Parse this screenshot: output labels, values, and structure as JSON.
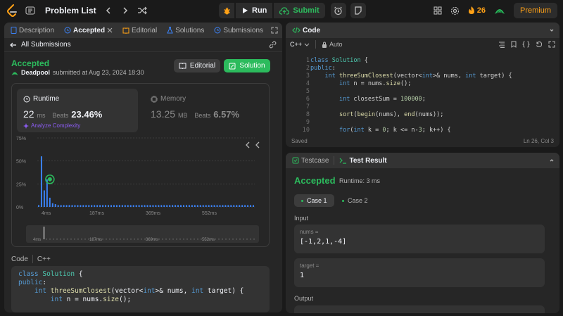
{
  "topbar": {
    "title": "Problem List",
    "run_label": "Run",
    "submit_label": "Submit",
    "streak_count": "26",
    "premium_label": "Premium"
  },
  "left_tabs": [
    {
      "label": "Description"
    },
    {
      "label": "Accepted"
    },
    {
      "label": "Editorial"
    },
    {
      "label": "Solutions"
    },
    {
      "label": "Submissions"
    }
  ],
  "submission": {
    "back_label": "All Submissions",
    "status": "Accepted",
    "user": "Deadpool",
    "submitted_text": "submitted at Aug 23, 2024 18:30",
    "editorial_btn": "Editorial",
    "solution_btn": "Solution",
    "runtime_label": "Runtime",
    "runtime_value": "22",
    "runtime_unit": "ms",
    "beats_label": "Beats",
    "runtime_beats": "23.46%",
    "analyze_label": "Analyze Complexity",
    "memory_label": "Memory",
    "memory_value": "13.25",
    "memory_unit": "MB",
    "memory_beats": "6.57%"
  },
  "chart_data": {
    "type": "bar",
    "y_ticks": [
      "75%",
      "50%",
      "25%",
      "0%"
    ],
    "x_ticks": [
      "4ms",
      "187ms",
      "369ms",
      "552ms"
    ],
    "mini_ticks": [
      "4ms",
      "187ms",
      "369ms",
      "552ms"
    ],
    "ylim": [
      0,
      75
    ],
    "values": [
      2,
      55,
      18,
      30,
      10,
      4,
      3,
      2,
      2,
      2,
      2,
      2,
      2,
      2,
      2,
      2,
      2,
      2,
      2,
      2,
      2,
      2,
      2,
      2,
      2,
      2,
      2,
      2,
      2,
      2,
      2,
      2,
      2,
      2,
      2,
      2,
      2,
      2,
      2,
      2,
      2,
      2,
      2,
      2,
      2,
      2,
      2,
      2,
      2,
      2,
      2,
      2,
      2,
      2,
      2,
      2,
      2,
      2,
      2,
      2,
      2,
      2,
      2,
      2,
      2,
      2,
      2,
      2,
      2,
      2,
      2,
      2,
      2,
      2,
      2,
      2,
      2,
      2
    ],
    "highlight_index": 3,
    "colors": {
      "bar": "#3b82f6",
      "highlight": "#2cbb5d"
    }
  },
  "left_code": {
    "label": "Code",
    "lang": "C++",
    "lines": [
      "class Solution {",
      "public:",
      "    int threeSumClosest(vector<int>& nums, int target) {",
      "        int n = nums.size();"
    ]
  },
  "editor": {
    "tab_label": "Code",
    "lang": "C++",
    "mode": "Auto",
    "line_numbers": [
      "1",
      "2",
      "3",
      "4",
      "5",
      "6",
      "7",
      "8",
      "9",
      "10"
    ],
    "lines": [
      "class Solution {",
      "public:",
      "    int threeSumClosest(vector<int>& nums, int target) {",
      "        int n = nums.size();",
      "",
      "        int closestSum = 100000;",
      "",
      "        sort(begin(nums), end(nums));",
      "",
      "        for(int k = 0; k <= n-3; k++) {"
    ],
    "status_left": "Saved",
    "status_right": "Ln 26, Col 3"
  },
  "result": {
    "tab_testcase": "Testcase",
    "tab_result": "Test Result",
    "status": "Accepted",
    "runtime": "Runtime: 3 ms",
    "case1": "Case 1",
    "case2": "Case 2",
    "input_label": "Input",
    "nums_name": "nums =",
    "nums_value": "[-1,2,1,-4]",
    "target_name": "target =",
    "target_value": "1",
    "output_label": "Output"
  }
}
